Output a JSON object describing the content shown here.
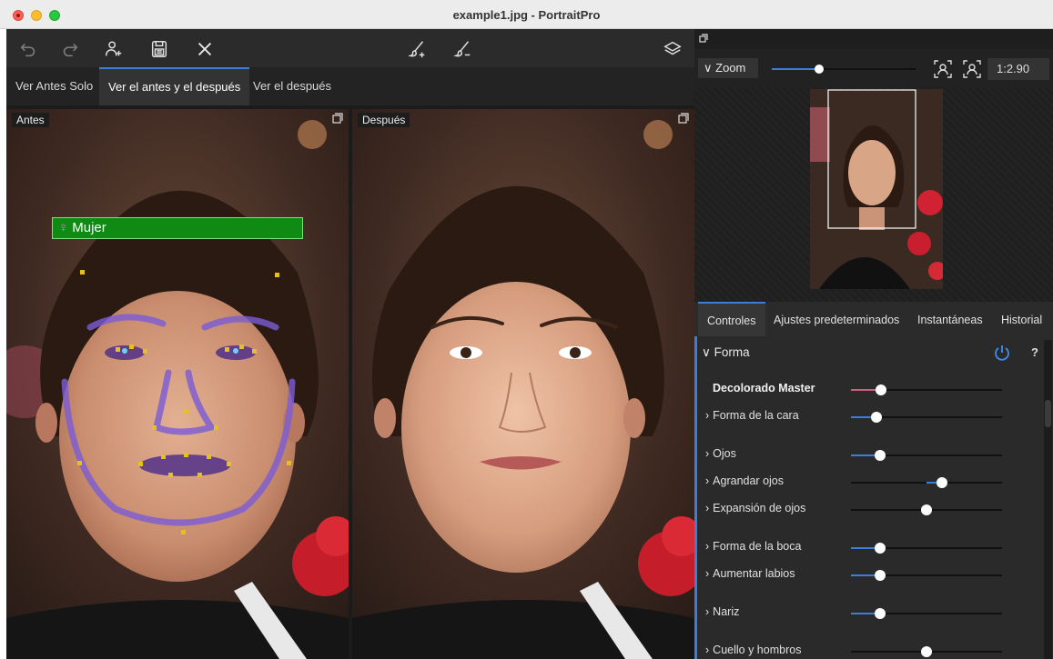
{
  "window": {
    "title": "example1.jpg - PortraitPro"
  },
  "toolbar": {
    "buttons": [
      "undo-icon",
      "redo-icon",
      "add-person-icon",
      "save-icon",
      "close-icon",
      "brush-add-icon",
      "brush-remove-icon",
      "layers-icon"
    ]
  },
  "view_tabs": [
    {
      "label": "Ver Antes Solo",
      "active": false
    },
    {
      "label": "Ver el antes y el después",
      "active": true
    },
    {
      "label": "Ver el después",
      "active": false
    }
  ],
  "panels": {
    "before_label": "Antes",
    "after_label": "Después",
    "gender_label": "Mujer"
  },
  "navigator": {
    "zoom_label": "Zoom",
    "zoom_value": "1:2.90",
    "zoom_slider_fraction": 0.33
  },
  "control_tabs": [
    {
      "label": "Controles",
      "active": true
    },
    {
      "label": "Ajustes predeterminados",
      "active": false
    },
    {
      "label": "Instantáneas",
      "active": false
    },
    {
      "label": "Historial",
      "active": false
    }
  ],
  "section": {
    "title": "Forma",
    "help": "?"
  },
  "sliders": [
    {
      "label": "Decolorado Master",
      "bold": true,
      "expand": false,
      "value": 0.2,
      "center": false,
      "color": "#c8607a"
    },
    {
      "label": "Forma de la cara",
      "bold": false,
      "expand": true,
      "value": 0.17,
      "center": false,
      "color": "#3b7ddd"
    },
    {
      "label": "Ojos",
      "bold": false,
      "expand": true,
      "value": 0.19,
      "center": false,
      "color": "#3b7ddd"
    },
    {
      "label": "Agrandar ojos",
      "bold": false,
      "expand": true,
      "value": 0.6,
      "center": true,
      "color": "#3b7ddd"
    },
    {
      "label": "Expansión de ojos",
      "bold": false,
      "expand": true,
      "value": 0.5,
      "center": true,
      "color": "#3b7ddd"
    },
    {
      "label": "Forma de la boca",
      "bold": false,
      "expand": true,
      "value": 0.19,
      "center": false,
      "color": "#3b7ddd"
    },
    {
      "label": "Aumentar labios",
      "bold": false,
      "expand": true,
      "value": 0.19,
      "center": false,
      "color": "#3b7ddd"
    },
    {
      "label": "Nariz",
      "bold": false,
      "expand": true,
      "value": 0.19,
      "center": false,
      "color": "#3b7ddd"
    },
    {
      "label": "Cuello y hombros",
      "bold": false,
      "expand": true,
      "value": 0.5,
      "center": true,
      "color": "#3b7ddd"
    }
  ]
}
